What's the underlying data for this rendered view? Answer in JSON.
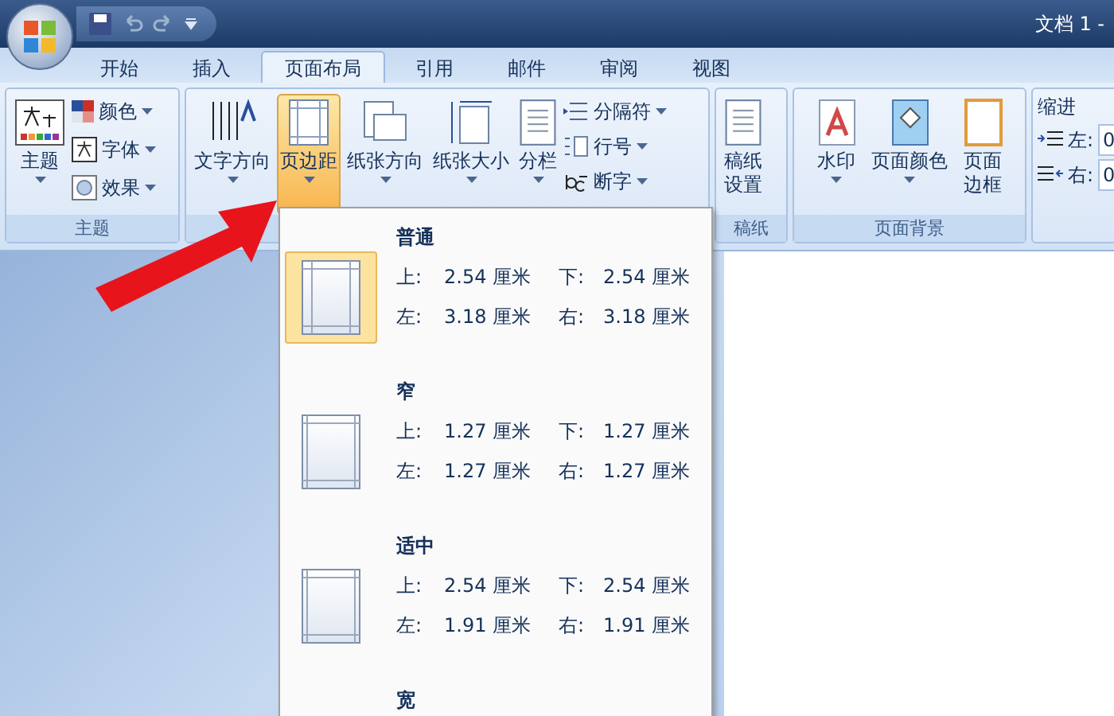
{
  "title": "文档 1 -",
  "tabs": [
    {
      "label": "开始",
      "selected": false
    },
    {
      "label": "插入",
      "selected": false
    },
    {
      "label": "页面布局",
      "selected": true
    },
    {
      "label": "引用",
      "selected": false
    },
    {
      "label": "邮件",
      "selected": false
    },
    {
      "label": "审阅",
      "selected": false
    },
    {
      "label": "视图",
      "selected": false
    }
  ],
  "theme_group": {
    "label": "主题",
    "big_button": "主题",
    "small_buttons": [
      "颜色",
      "字体",
      "效果"
    ]
  },
  "page_setup_group": {
    "big_buttons": [
      {
        "label": "文字方向",
        "selected": false
      },
      {
        "label": "页边距",
        "selected": true
      },
      {
        "label": "纸张方向",
        "selected": false
      },
      {
        "label": "纸张大小",
        "selected": false
      },
      {
        "label": "分栏",
        "selected": false
      }
    ],
    "small_buttons": [
      "分隔符",
      "行号",
      "断字"
    ]
  },
  "draft_group": {
    "label": "稿纸",
    "button": "稿纸设置"
  },
  "background_group": {
    "label": "页面背景",
    "buttons": [
      {
        "label": "水印",
        "dropdown": true
      },
      {
        "label": "页面颜色",
        "dropdown": true
      },
      {
        "label": "页面边框",
        "dropdown": false
      }
    ]
  },
  "paragraph_group": {
    "heading": "缩进",
    "fields": [
      {
        "label": "左:",
        "value": "0"
      },
      {
        "label": "右:",
        "value": "0"
      }
    ]
  },
  "margins_menu": {
    "presets": [
      {
        "name": "普通",
        "selected": true,
        "rows": [
          [
            "上:",
            "2.54 厘米",
            "下:",
            "2.54 厘米"
          ],
          [
            "左:",
            "3.18 厘米",
            "右:",
            "3.18 厘米"
          ]
        ]
      },
      {
        "name": "窄",
        "selected": false,
        "rows": [
          [
            "上:",
            "1.27 厘米",
            "下:",
            "1.27 厘米"
          ],
          [
            "左:",
            "1.27 厘米",
            "右:",
            "1.27 厘米"
          ]
        ]
      },
      {
        "name": "适中",
        "selected": false,
        "rows": [
          [
            "上:",
            "2.54 厘米",
            "下:",
            "2.54 厘米"
          ],
          [
            "左:",
            "1.91 厘米",
            "右:",
            "1.91 厘米"
          ]
        ]
      },
      {
        "name": "宽",
        "selected": false
      }
    ]
  }
}
